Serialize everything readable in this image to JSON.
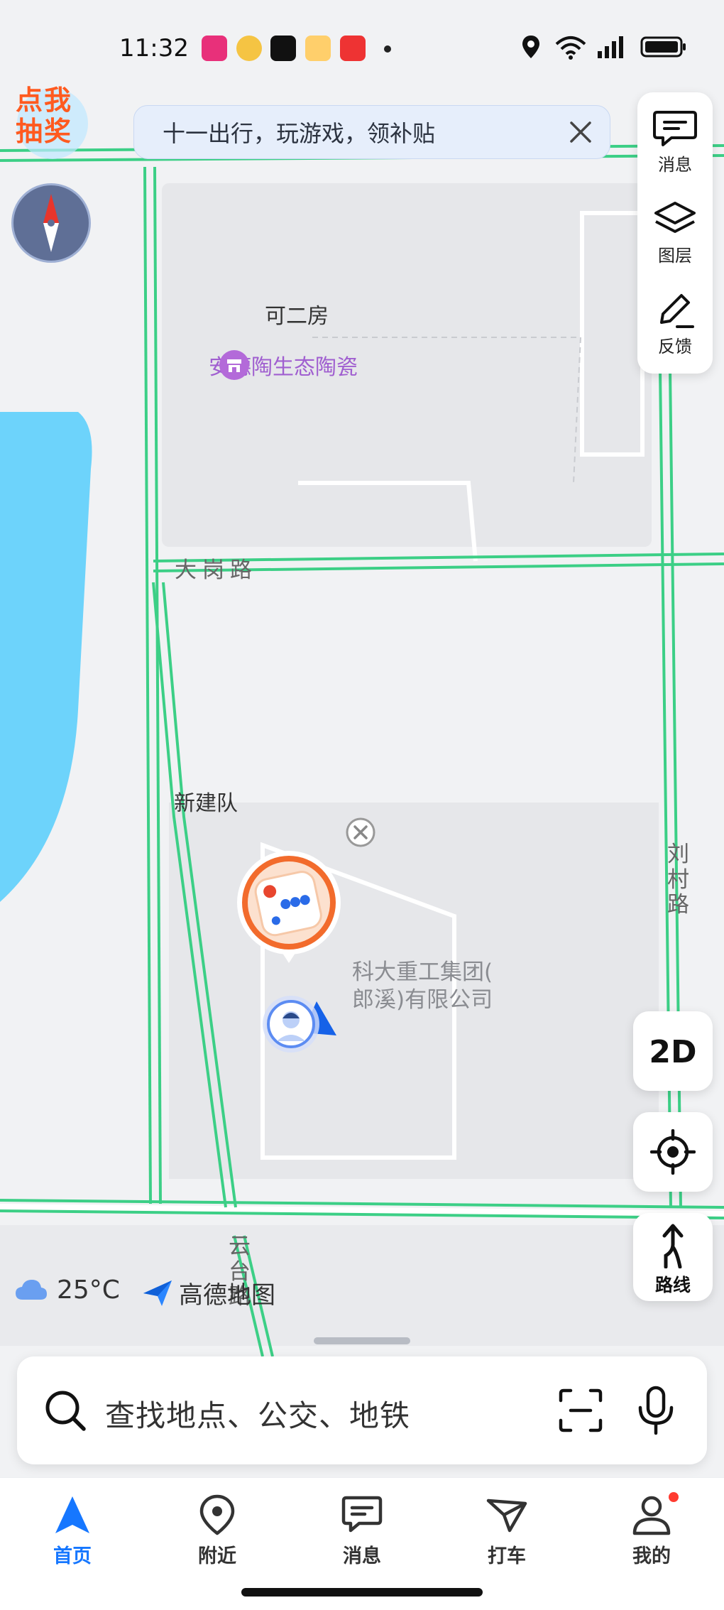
{
  "status_bar": {
    "time": "11:32",
    "battery_icon": "battery-icon",
    "signal_icon": "signal-icon",
    "wifi_icon": "wifi-icon"
  },
  "banner": {
    "text": "十一出行，玩游戏，领补贴"
  },
  "lottery_badge": {
    "line1": "点我",
    "line2": "抽奖"
  },
  "right_panel": {
    "items": [
      {
        "label": "消息",
        "icon": "message-icon"
      },
      {
        "label": "图层",
        "icon": "layers-icon"
      },
      {
        "label": "反馈",
        "icon": "feedback-icon"
      }
    ]
  },
  "map": {
    "labels": {
      "village1": "可二房",
      "poi_ceramics": "安德陶生态陶瓷",
      "road_dagang": "大岗路",
      "village2": "新建队",
      "company_line1": "科大重工集团(",
      "company_line2": "郎溪)有限公司",
      "road_liucun": "刘村路",
      "road_yuntai": "云台路"
    }
  },
  "map_buttons": {
    "mode_2d": "2D",
    "route": "路线"
  },
  "weather": {
    "temperature": "25°C",
    "icon": "cloud-icon"
  },
  "brand": {
    "name": "高德地图"
  },
  "search": {
    "placeholder": "查找地点、公交、地铁"
  },
  "bottom_nav": {
    "items": [
      {
        "label": "首页",
        "active": true
      },
      {
        "label": "附近",
        "active": false
      },
      {
        "label": "消息",
        "active": false
      },
      {
        "label": "打车",
        "active": false
      },
      {
        "label": "我的",
        "active": false
      }
    ]
  },
  "colors": {
    "accent": "#1677ff",
    "road_green": "#3ccf86",
    "water": "#6dd3fb",
    "poi_purple": "#a05fd0"
  }
}
